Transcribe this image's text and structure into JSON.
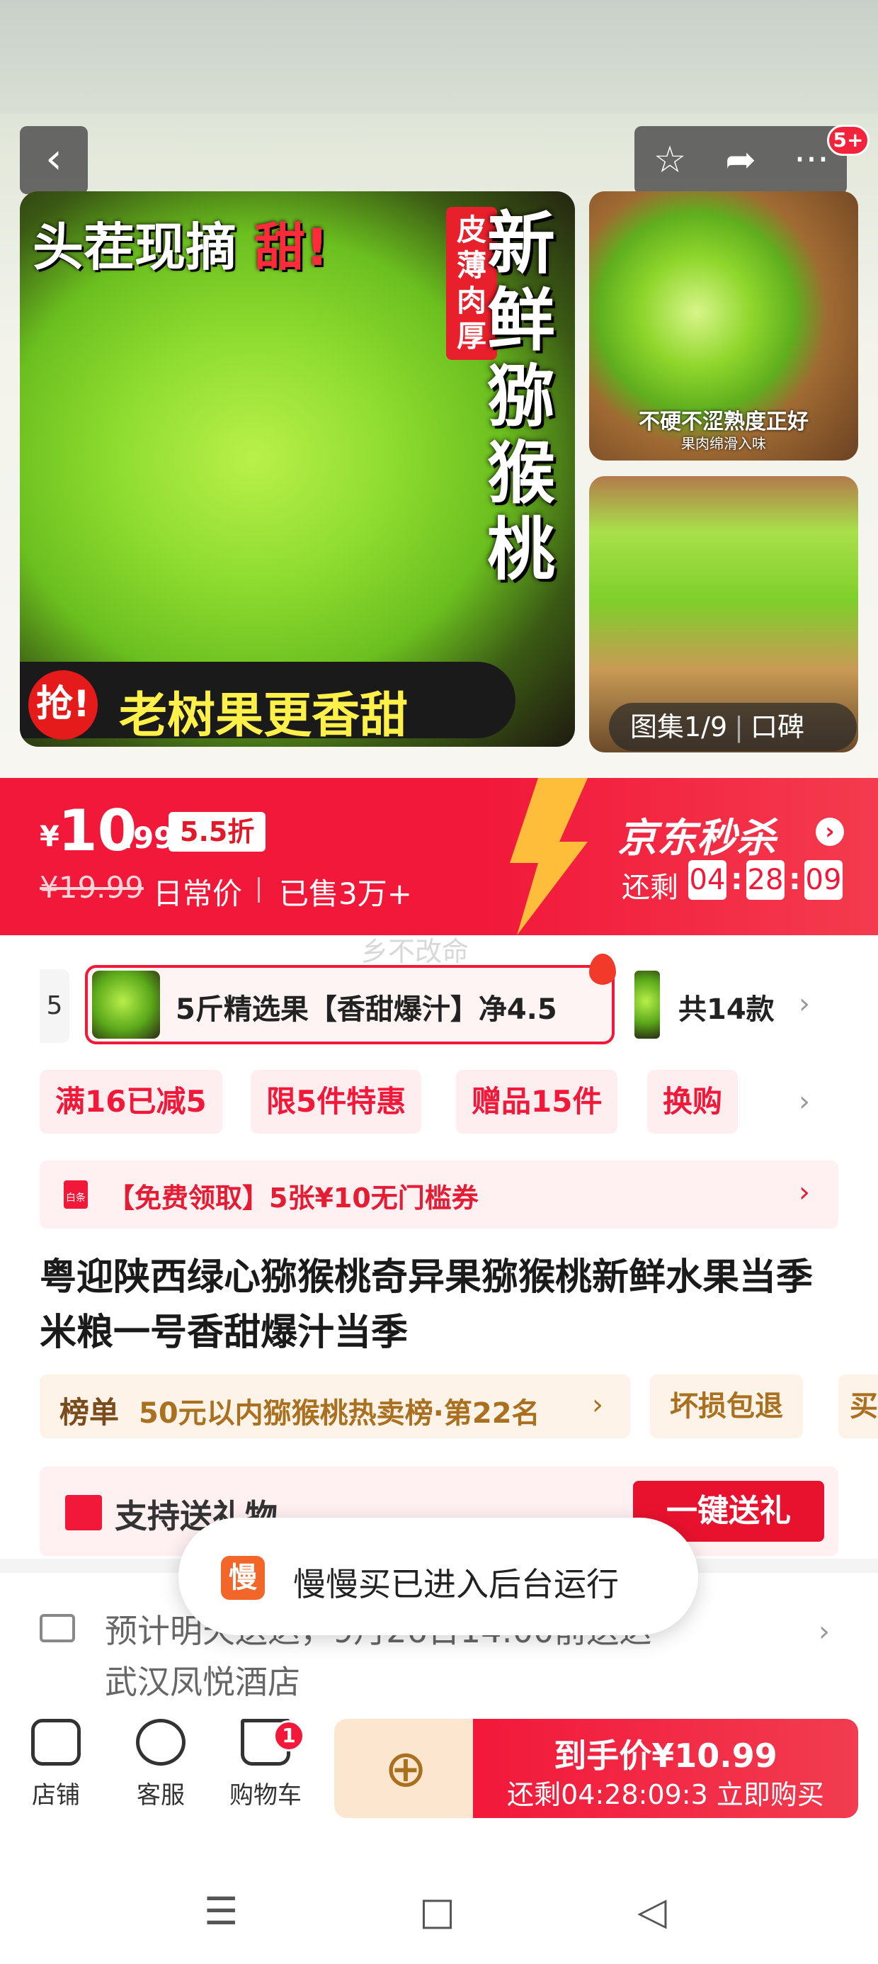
{
  "header": {
    "back_icon": "chevron-left-icon",
    "actions": [
      "star-icon",
      "share-icon",
      "more-icon"
    ],
    "message_badge": "5+"
  },
  "gallery": {
    "main_headline": "头茬现摘",
    "main_headline_sweet": "甜!",
    "main_vertical": "新鲜猕猴桃",
    "main_tag": "皮薄肉厚",
    "main_rob": "抢!",
    "main_banner": "老树果更香甜",
    "side1_text": "不硬不涩熟度正好",
    "side1_sub": "果肉绵滑入味",
    "counter": "图集1/9",
    "counter_tab": "口碑"
  },
  "price": {
    "currency": "¥",
    "integer": "10",
    "fraction": ".99",
    "discount": "5.5折",
    "original": "¥19.99",
    "original_label": "日常价",
    "sold": "已售3万+",
    "seckill_title": "京东秒杀",
    "remain_label": "还剩",
    "countdown": [
      "04",
      "28",
      "09"
    ]
  },
  "variants": {
    "ghost": "乡不改命",
    "prev": "5",
    "selected": "5斤精选果【香甜爆汁】净4.5",
    "total": "共14款"
  },
  "promos": [
    "满16已减5",
    "限5件特惠",
    "赠品15件",
    "换购"
  ],
  "coupon": "【免费领取】5张¥10无门槛券",
  "coupon_icon_label": "白条",
  "title": "粤迎陕西绿心猕猴桃奇异果猕猴桃新鲜水果当季米粮一号香甜爆汁当季",
  "rank": {
    "label": "榜单",
    "text": "50元以内猕猴桃热卖榜·第22名",
    "chips": [
      "坏损包退",
      "买"
    ]
  },
  "gift": {
    "text": "支持送礼物",
    "button": "一键送礼"
  },
  "shipping": {
    "line1": "预计明天送达，9月26日14:00前送达",
    "line2": "武汉凤悦酒店"
  },
  "toast": {
    "icon_text": "慢",
    "text": "慢慢买已进入后台运行"
  },
  "bottom": {
    "store": "店铺",
    "service": "客服",
    "cart": "购物车",
    "cart_count": "1",
    "buy_line1": "到手价¥10.99",
    "buy_line2": "还剩04:28:09:3 立即购买"
  },
  "system_nav": [
    "menu-icon",
    "home-icon",
    "back-icon"
  ],
  "colors": {
    "accent": "#f2183a",
    "coupon_text": "#e41c34",
    "rank_text": "#a8701f"
  }
}
